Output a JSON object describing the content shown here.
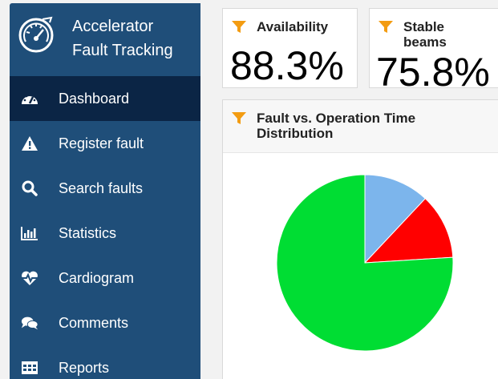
{
  "app": {
    "title_line1": "Accelerator",
    "title_line2": "Fault Tracking"
  },
  "sidebar": {
    "items": [
      {
        "label": "Dashboard",
        "icon": "dashboard-gauge-icon",
        "active": true
      },
      {
        "label": "Register fault",
        "icon": "warning-triangle-icon",
        "active": false
      },
      {
        "label": "Search faults",
        "icon": "search-icon",
        "active": false
      },
      {
        "label": "Statistics",
        "icon": "bar-chart-icon",
        "active": false
      },
      {
        "label": "Cardiogram",
        "icon": "heartbeat-icon",
        "active": false
      },
      {
        "label": "Comments",
        "icon": "comments-icon",
        "active": false
      },
      {
        "label": "Reports",
        "icon": "table-icon",
        "active": false
      }
    ]
  },
  "kpis": [
    {
      "label": "Availability",
      "value": "88.3%",
      "icon": "filter-icon"
    },
    {
      "label": "Stable beams",
      "label_line1": "Stable",
      "label_line2": "beams",
      "value": "75.8%",
      "icon": "filter-icon"
    }
  ],
  "distribution_card": {
    "title_line1": "Fault vs. Operation Time",
    "title_line2": "Distribution",
    "icon": "filter-icon"
  },
  "chart_data": {
    "type": "pie",
    "title": "",
    "slices": [
      {
        "label": "",
        "value": 12,
        "color": "#7cb5ec"
      },
      {
        "label": "",
        "value": 12,
        "color": "#ff0000"
      },
      {
        "label": "",
        "value": 76,
        "color": "#00dd33"
      }
    ]
  },
  "colors": {
    "sidebar": "#1f4e79",
    "sidebar_active": "#0b2545",
    "funnel": "#f39c12"
  }
}
